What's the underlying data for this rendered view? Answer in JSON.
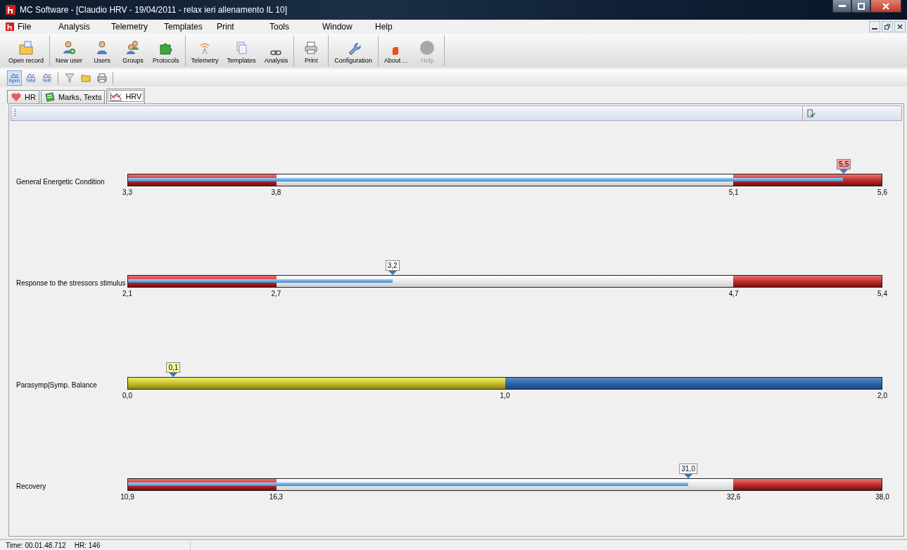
{
  "window": {
    "title": "MC Software - [Claudio HRV - 19/04/2011 - relax ieri allenamento IL 10]"
  },
  "menu": [
    "File",
    "Analysis",
    "Telemetry",
    "Templates",
    "Print",
    "Tools",
    "Window",
    "Help"
  ],
  "toolbar": [
    [
      {
        "label": "Open record",
        "kind": "folder",
        "disabled": false
      }
    ],
    [
      {
        "label": "New user",
        "kind": "user-add",
        "disabled": false
      },
      {
        "label": "Users",
        "kind": "user",
        "disabled": false
      },
      {
        "label": "Groups",
        "kind": "users",
        "disabled": false
      },
      {
        "label": "Protocols",
        "kind": "puzzle",
        "disabled": false
      }
    ],
    [
      {
        "label": "Telemetry",
        "kind": "antenna",
        "disabled": false
      },
      {
        "label": "Templates",
        "kind": "pages",
        "disabled": false
      },
      {
        "label": "Analysis",
        "kind": "link",
        "disabled": false
      }
    ],
    [
      {
        "label": "Print",
        "kind": "printer",
        "disabled": false
      }
    ],
    [
      {
        "label": "Configuration",
        "kind": "wrench",
        "disabled": false
      }
    ],
    [
      {
        "label": "About ...",
        "kind": "stop",
        "disabled": false
      },
      {
        "label": "Help",
        "kind": "circle",
        "disabled": true
      }
    ]
  ],
  "view_toggles": [
    {
      "label": "bpm",
      "selected": true
    },
    {
      "label": "%M",
      "selected": false
    },
    {
      "label": "%R",
      "selected": false
    }
  ],
  "tabs": [
    {
      "label": "HR",
      "kind": "heart",
      "selected": false
    },
    {
      "label": "Marks, Texts",
      "kind": "note",
      "selected": false
    },
    {
      "label": "HRV",
      "kind": "chart",
      "selected": true
    }
  ],
  "gauges": [
    {
      "name": "General Energetic Condition",
      "kind": "zones",
      "level": 0.949,
      "value": "5,5",
      "ticks": [
        "3,3",
        "3,8",
        "5,1",
        "5,6"
      ]
    },
    {
      "name": "Response to the  stressors stimulus",
      "kind": "zones",
      "level": 0.351,
      "value": "3,2",
      "ticks": [
        "2,1",
        "2,7",
        "4,7",
        "5,4"
      ]
    },
    {
      "name": "Parasymp|Symp. Balance",
      "kind": "balance",
      "level": 0.061,
      "value": "0,1",
      "ticks": [
        "0,0",
        "1,0",
        "2,0"
      ]
    },
    {
      "name": "Recovery",
      "kind": "zones",
      "level": 0.743,
      "value": "31,0",
      "ticks": [
        "10,9",
        "16,3",
        "32,6",
        "38,0"
      ]
    }
  ],
  "status_bar": {
    "time": "Time: 00.01.48.712",
    "hr": "HR: 146"
  }
}
